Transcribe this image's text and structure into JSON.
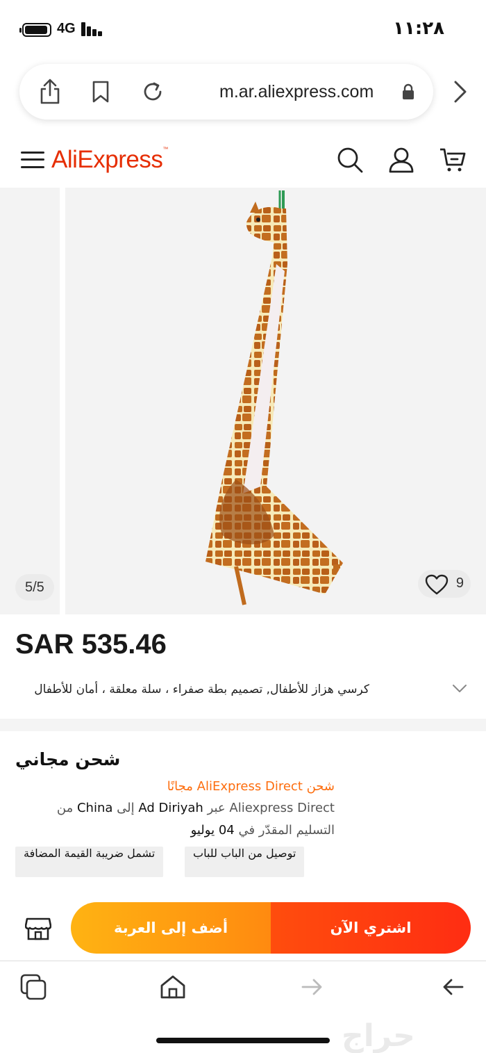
{
  "status_bar": {
    "network": "4G",
    "time": "١١:٢٨"
  },
  "browser": {
    "url": "m.ar.aliexpress.com"
  },
  "site": {
    "logo": "AliExpress",
    "logo_mark": "™"
  },
  "product": {
    "image_index": "5/5",
    "wishlist_count": "9",
    "price": "SAR 535.46",
    "title": "كرسي هزاز للأطفال, تصميم بطة صفراء ، سلة معلقة ، أمان للأطفال"
  },
  "shipping": {
    "title": "شحن مجاني",
    "free_line": "شحن AliExpress Direct مجانًا",
    "route_line_parts": [
      "Aliexpress Direct عبر ",
      "Ad Diriyah",
      " إلى ",
      "China",
      " من"
    ],
    "delivery_line_parts": [
      "التسليم المقدّر في ",
      "04",
      " يوليو"
    ],
    "chips": [
      "توصيل من الباب للباب",
      "تشمل ضريبة القيمة المضافة"
    ]
  },
  "actions": {
    "buy_now": "اشتري الآن",
    "add_to_cart": "أضف إلى العربة"
  },
  "watermark": "حراج",
  "colors": {
    "brand": "#e62e04",
    "orange_text": "#fd6d0e",
    "buy": "#ff3c10",
    "cart": "#ffa011"
  }
}
